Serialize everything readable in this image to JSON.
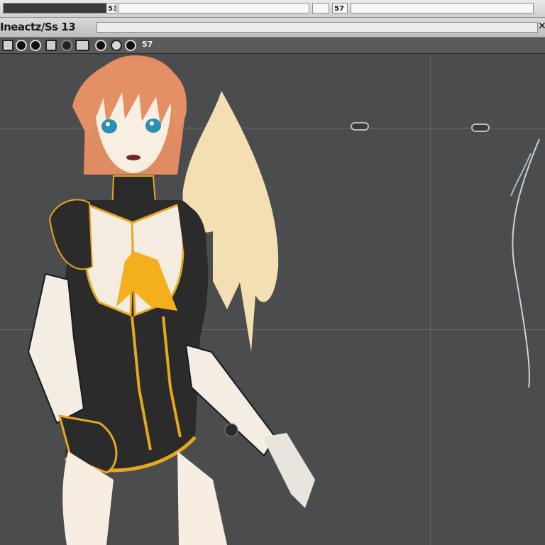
{
  "window": {
    "title_field": "",
    "title_code": "53",
    "title_code2": "57"
  },
  "menubar": {
    "title": "Ineactz/Ss 13"
  },
  "toolbar": {
    "tool_label": "57"
  },
  "colors": {
    "canvas": "#4b4c4d",
    "hair": "#d98a5e",
    "outfit_dark": "#2b2b2b",
    "outfit_accent": "#e6a81f",
    "skin": "#f4e8d8"
  },
  "icons": {
    "tool1": "circle-tool-icon",
    "tool2": "circle-tool-icon",
    "tool3": "square-tool-icon",
    "tool4": "record-icon"
  }
}
